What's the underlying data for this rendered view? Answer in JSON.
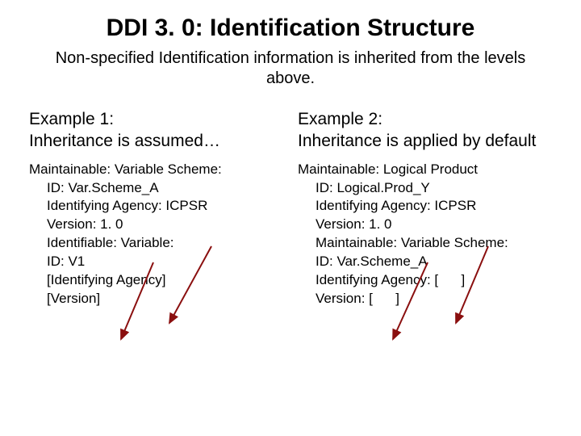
{
  "title": "DDI 3. 0: Identification Structure",
  "subtitle": "Non-specified Identification information is inherited from the levels above.",
  "example1": {
    "head1": "Example 1:",
    "head2": "Inheritance is assumed…",
    "l1": "Maintainable: Variable Scheme:",
    "l2": "ID: Var.Scheme_A",
    "l3": "Identifying Agency: ICPSR",
    "l4": "Version: 1. 0",
    "l5": "Identifiable: Variable:",
    "l6": "ID: V1",
    "l7": "[Identifying Agency]",
    "l8": "[Version]"
  },
  "example2": {
    "head1": "Example 2:",
    "head2": "Inheritance is applied by default",
    "l1": "Maintainable: Logical Product",
    "l2": "ID: Logical.Prod_Y",
    "l3": "Identifying Agency: ICPSR",
    "l4": "Version: 1. 0",
    "l5": "Maintainable: Variable Scheme:",
    "l6": "ID: Var.Scheme_A",
    "l7a": "Identifying Agency:  [",
    "l7b": "]",
    "l8a": "Version:  [",
    "l8b": "]"
  }
}
